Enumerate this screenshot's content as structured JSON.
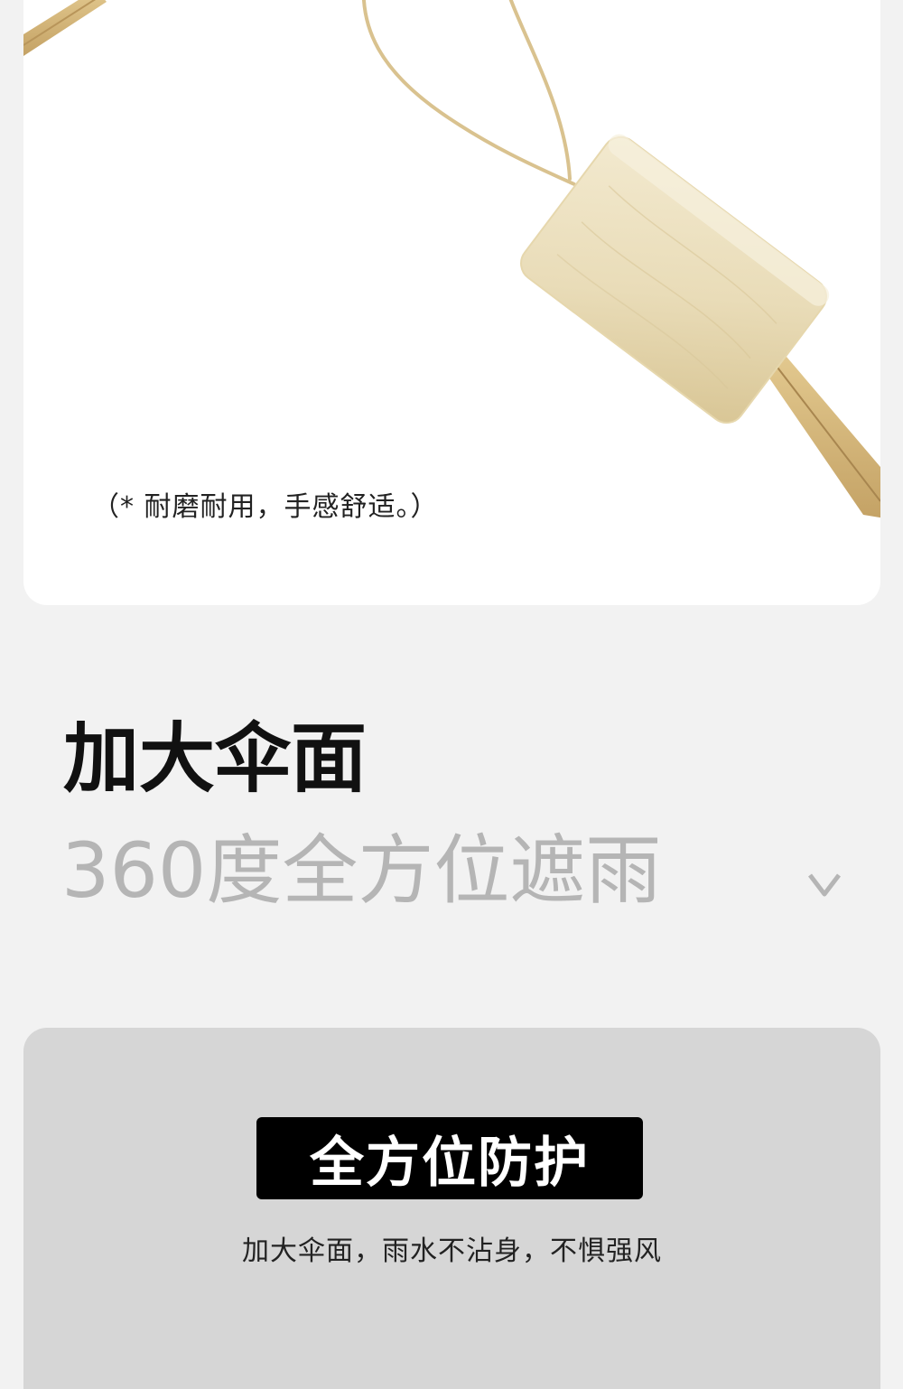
{
  "top_card": {
    "caption": "（* 耐磨耐用，手感舒适。）"
  },
  "section": {
    "title": "加大伞面",
    "subtitle": "360度全方位遮雨"
  },
  "bottom_card": {
    "badge": "全方位防护",
    "description": "加大伞面，雨水不沾身，不惧强风"
  },
  "icons": {
    "chevron": "chevron-down-icon"
  },
  "colors": {
    "page_bg": "#f2f2f2",
    "card_white": "#ffffff",
    "card_grey": "#d6d6d6",
    "title": "#111111",
    "subtitle": "#b5b5b5",
    "badge_bg": "#000000",
    "wood": "#e9dcb8",
    "bamboo": "#d2b57c"
  }
}
